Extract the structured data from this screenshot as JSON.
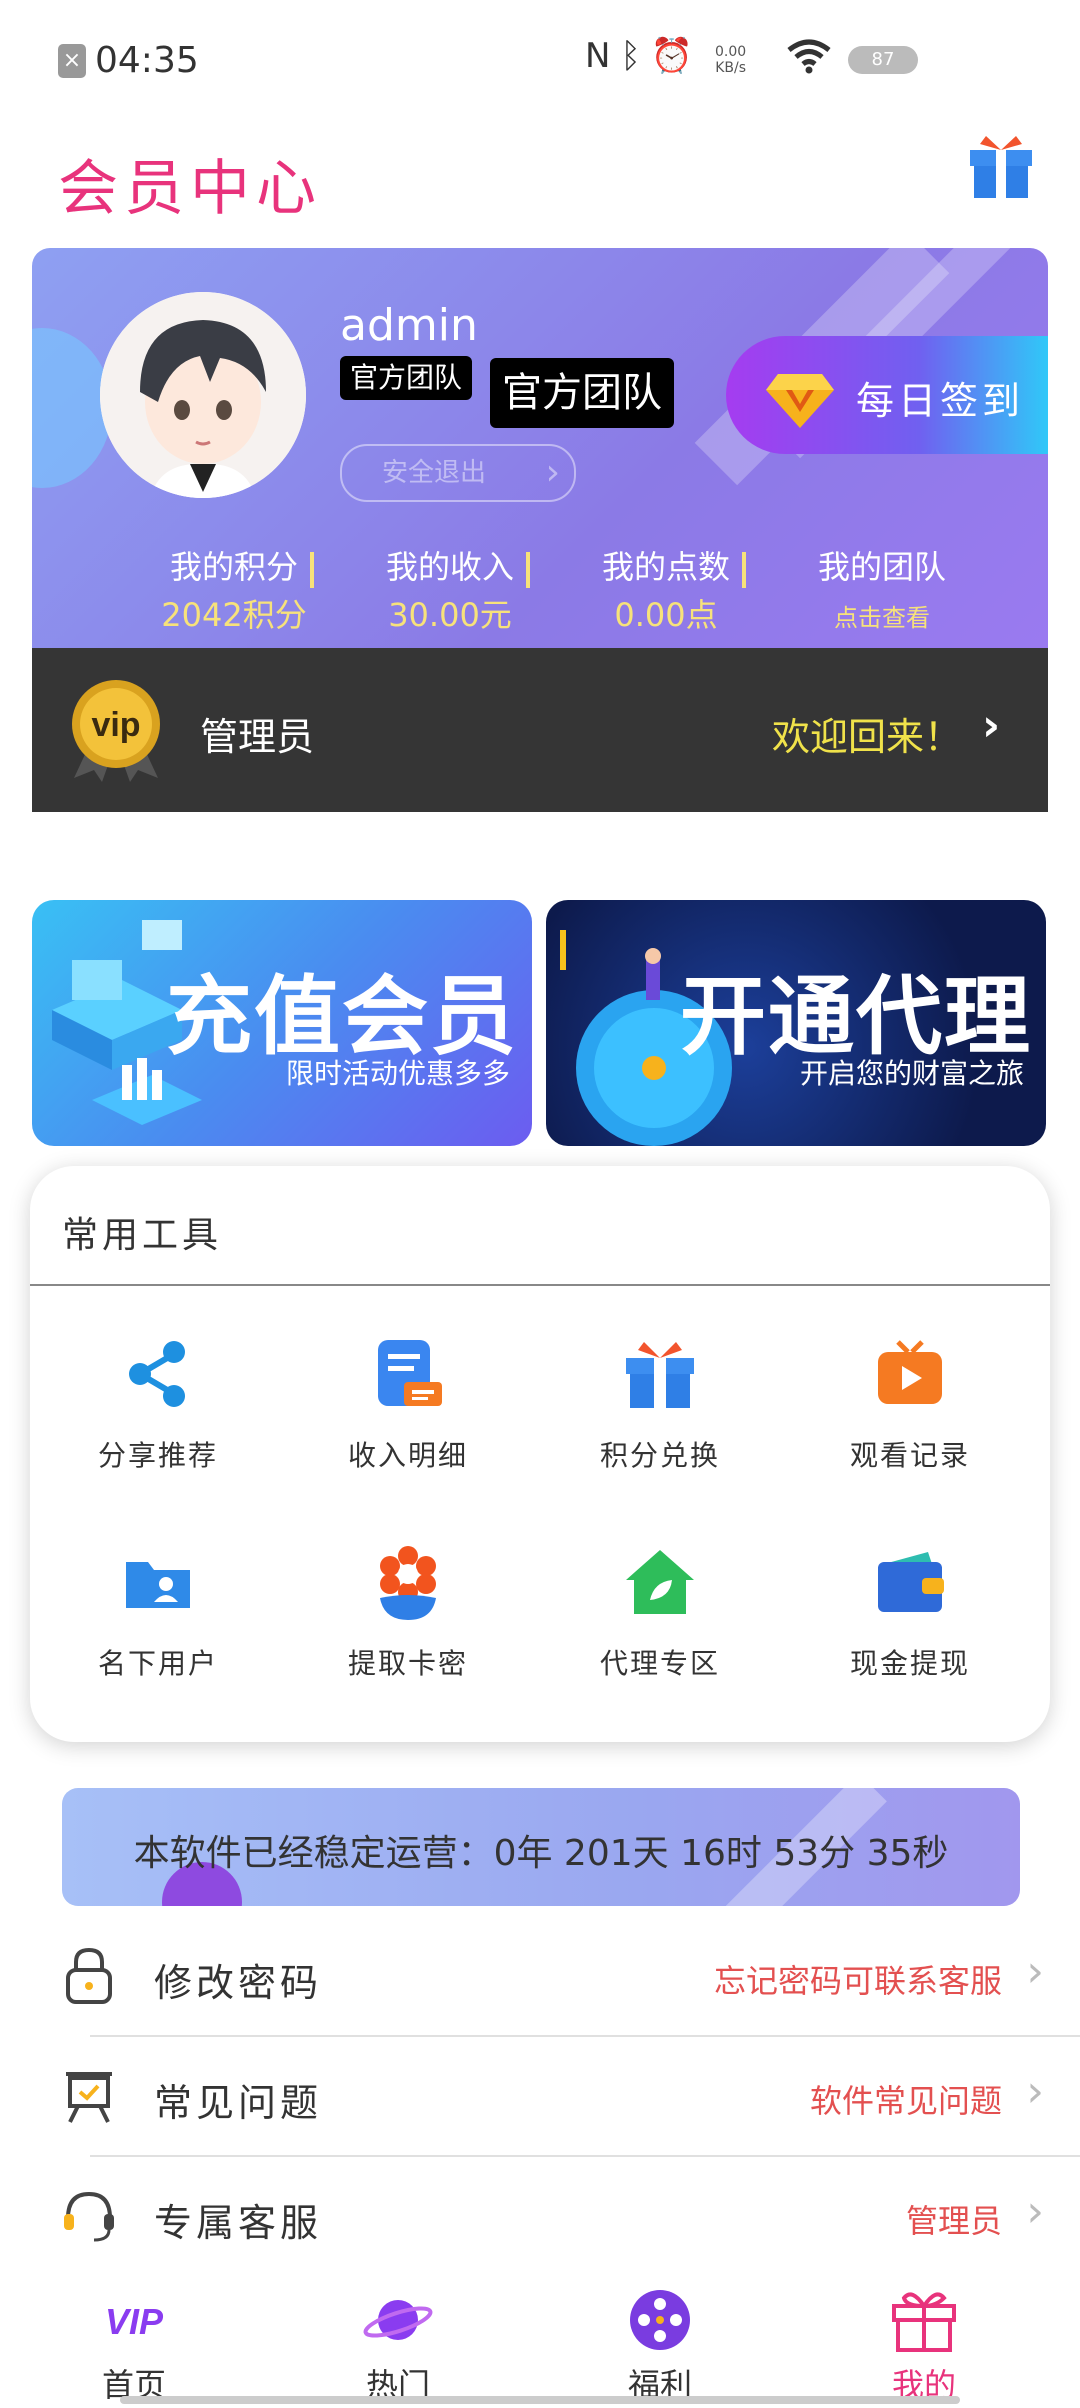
{
  "status": {
    "time": "04:35",
    "net_speed_value": "0.00",
    "net_speed_unit": "KB/s",
    "battery": "87"
  },
  "header": {
    "title": "会员中心"
  },
  "profile": {
    "username": "admin",
    "badge_small": "官方团队",
    "badge_large": "官方团队",
    "logout_label": "安全退出",
    "checkin_label": "每日签到",
    "stats": [
      {
        "label": "我的积分",
        "value": "2042积分"
      },
      {
        "label": "我的收入",
        "value": "30.00元"
      },
      {
        "label": "我的点数",
        "value": "0.00点"
      },
      {
        "label": "我的团队",
        "value": "点击查看"
      }
    ]
  },
  "vip": {
    "badge_text": "vip",
    "role": "管理员",
    "welcome": "欢迎回来！"
  },
  "banners": [
    {
      "title": "充值会员",
      "subtitle": "限时活动优惠多多"
    },
    {
      "title": "开通代理",
      "subtitle": "开启您的财富之旅"
    }
  ],
  "tools": {
    "title": "常用工具",
    "items": [
      {
        "label": "分享推荐",
        "icon": "share-icon",
        "color": "#1e90e0"
      },
      {
        "label": "收入明细",
        "icon": "document-icon",
        "color": "#3a86f0"
      },
      {
        "label": "积分兑换",
        "icon": "gift-icon",
        "color": "#2f8ae8"
      },
      {
        "label": "观看记录",
        "icon": "tv-play-icon",
        "color": "#f57a22"
      },
      {
        "label": "名下用户",
        "icon": "user-folder-icon",
        "color": "#2f8ae8"
      },
      {
        "label": "提取卡密",
        "icon": "flower-icon",
        "color": "#f2541e"
      },
      {
        "label": "代理专区",
        "icon": "house-leaf-icon",
        "color": "#2ebd5a"
      },
      {
        "label": "现金提现",
        "icon": "wallet-icon",
        "color": "#2f6ad8"
      }
    ]
  },
  "uptime": {
    "text": "本软件已经稳定运营：0年  201天  16时  53分  35秒"
  },
  "menu": [
    {
      "label": "修改密码",
      "hint": "忘记密码可联系客服",
      "icon": "lock-icon"
    },
    {
      "label": "常见问题",
      "hint": "软件常见问题",
      "icon": "easel-icon"
    },
    {
      "label": "专属客服",
      "hint": "管理员",
      "icon": "headset-icon"
    }
  ],
  "nav": [
    {
      "label": "首页",
      "icon": "vip-icon"
    },
    {
      "label": "热门",
      "icon": "planet-icon"
    },
    {
      "label": "福利",
      "icon": "film-reel-icon"
    },
    {
      "label": "我的",
      "icon": "gift-icon"
    }
  ],
  "colors": {
    "accent": "#e8337c",
    "gold": "#f7e27a",
    "dark_bar": "#353535"
  }
}
